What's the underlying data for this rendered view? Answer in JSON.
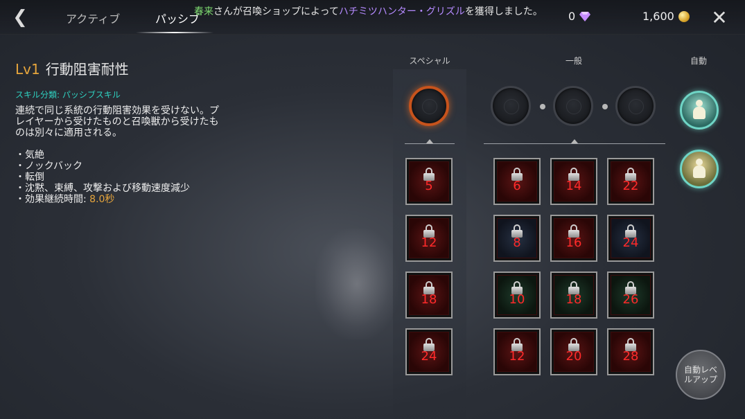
{
  "header": {
    "tabs": [
      {
        "label": "アクティブ"
      },
      {
        "label": "パッシブ"
      }
    ],
    "notice": {
      "player": "春来",
      "middle": "さんが召喚ショップによって",
      "item": "ハチミツハンター・グリズル",
      "suffix": "を獲得しました。"
    },
    "gems": "0",
    "coins": "1,600"
  },
  "skill": {
    "level": "Lv1",
    "name": "行動阻害耐性",
    "category": "スキル分類: パッシブスキル",
    "description": "連続で同じ系統の行動阻害効果を受けない。プレイヤーから受けたものと召喚獣から受けたものは別々に適用される。",
    "effects": [
      "気絶",
      "ノックバック",
      "転倒",
      "沈黙、束縛、攻撃および移動速度減少"
    ],
    "duration_label": "効果継続時間: ",
    "duration_value": "8.0秒"
  },
  "columns": {
    "special": "スペシャル",
    "general": "一般",
    "auto": "自動"
  },
  "special_cards": [
    "5",
    "12",
    "18",
    "24"
  ],
  "general_cards": [
    [
      "6",
      "14",
      "22"
    ],
    [
      "8",
      "16",
      "24"
    ],
    [
      "10",
      "18",
      "26"
    ],
    [
      "12",
      "20",
      "28"
    ]
  ],
  "auto_levelup_label": "自動レベ\nルアップ",
  "colors": {
    "accent_orange": "#e6a53c",
    "category_teal": "#2fd3c2",
    "player_green": "#7dd96f",
    "item_purple": "#b58aff",
    "locked_level_red": "#ff2a2a"
  }
}
